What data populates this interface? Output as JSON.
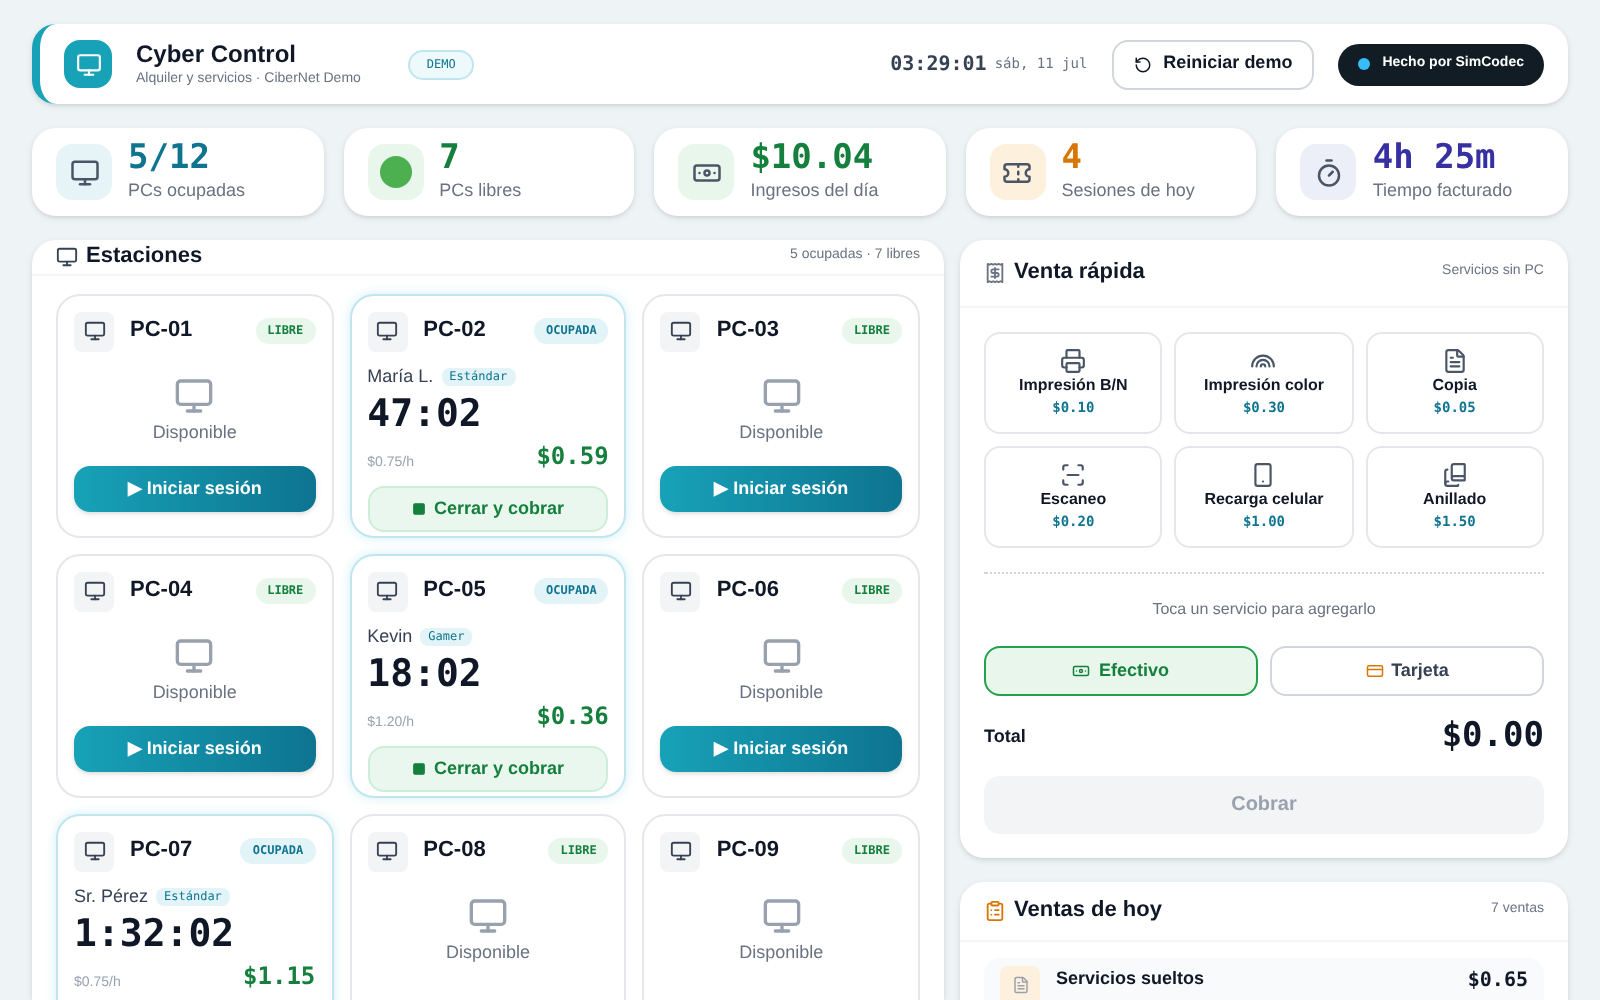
{
  "header": {
    "title": "Cyber Control",
    "subtitle": "Alquiler y servicios · CiberNet Demo",
    "badge": "DEMO",
    "time": "03:29:01",
    "date": "sáb, 11 jul",
    "reset_button": "Reiniciar demo",
    "made_by": "Hecho por SimCodec"
  },
  "stats": [
    {
      "kind": "monitor",
      "value": "5/12",
      "label": "PCs ocupadas",
      "color": "#0e7490"
    },
    {
      "kind": "dot",
      "value": "7",
      "label": "PCs libres",
      "color": "#15803d"
    },
    {
      "kind": "money",
      "value": "$10.04",
      "label": "Ingresos del día",
      "color": "#15803d"
    },
    {
      "kind": "ticket",
      "value": "4",
      "label": "Sesiones de hoy",
      "color": "#d97706"
    },
    {
      "kind": "timer",
      "value": "4h 25m",
      "label": "Tiempo facturado",
      "color": "#3730a3"
    }
  ],
  "stations": {
    "title": "Estaciones",
    "summary": "5 ocupadas · 7 libres",
    "pcs": [
      {
        "name": "PC-01",
        "kind": "libre",
        "status": "LIBRE",
        "note": "Disponible",
        "action": "▶ Iniciar sesión"
      },
      {
        "name": "PC-02",
        "kind": "ocupada",
        "status": "OCUPADA",
        "user": "María L.",
        "plan": "Estándar",
        "timer": "47:02",
        "rate": "$0.75/h",
        "amount": "$0.59",
        "action": "Cerrar y cobrar"
      },
      {
        "name": "PC-03",
        "kind": "libre",
        "status": "LIBRE",
        "note": "Disponible",
        "action": "▶ Iniciar sesión"
      },
      {
        "name": "PC-04",
        "kind": "libre",
        "status": "LIBRE",
        "note": "Disponible",
        "action": "▶ Iniciar sesión"
      },
      {
        "name": "PC-05",
        "kind": "ocupada",
        "status": "OCUPADA",
        "user": "Kevin",
        "plan": "Gamer",
        "timer": "18:02",
        "rate": "$1.20/h",
        "amount": "$0.36",
        "action": "Cerrar y cobrar"
      },
      {
        "name": "PC-06",
        "kind": "libre",
        "status": "LIBRE",
        "note": "Disponible",
        "action": "▶ Iniciar sesión"
      },
      {
        "name": "PC-07",
        "kind": "ocupada",
        "status": "OCUPADA",
        "user": "Sr. Pérez",
        "plan": "Estándar",
        "timer": "1:32:02",
        "rate": "$0.75/h",
        "amount": "$1.15"
      },
      {
        "name": "PC-08",
        "kind": "libre",
        "status": "LIBRE",
        "note": "Disponible"
      },
      {
        "name": "PC-09",
        "kind": "libre",
        "status": "LIBRE",
        "note": "Disponible"
      }
    ]
  },
  "quick_sale": {
    "title": "Venta rápida",
    "subtitle": "Servicios sin PC",
    "services": [
      {
        "kind": "printer",
        "name": "Impresión B/N",
        "price": "$0.10"
      },
      {
        "kind": "rainbow",
        "name": "Impresión color",
        "price": "$0.30"
      },
      {
        "kind": "page",
        "name": "Copia",
        "price": "$0.05"
      },
      {
        "kind": "scanner",
        "name": "Escaneo",
        "price": "$0.20"
      },
      {
        "kind": "phone",
        "name": "Recarga celular",
        "price": "$1.00"
      },
      {
        "kind": "books",
        "name": "Anillado",
        "price": "$1.50"
      }
    ],
    "hint": "Toca un servicio para agregarlo",
    "payment_methods": [
      {
        "kind": "cash",
        "label": "Efectivo",
        "selected": true
      },
      {
        "kind": "card",
        "label": "Tarjeta",
        "selected": false
      }
    ],
    "total_label": "Total",
    "total": "$0.00",
    "charge_button": {
      "label": "Cobrar",
      "disabled": true
    }
  },
  "sales_today": {
    "title": "Ventas de hoy",
    "count": "7 ventas",
    "items": [
      {
        "name": "Servicios sueltos",
        "amount": "$0.65"
      }
    ]
  }
}
